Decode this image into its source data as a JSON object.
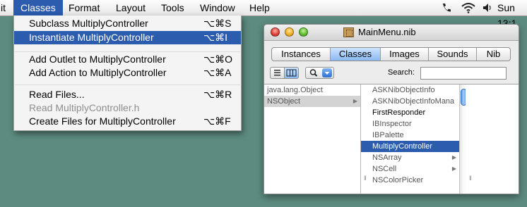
{
  "menubar": {
    "items": [
      "it",
      "Classes",
      "Format",
      "Layout",
      "Tools",
      "Window",
      "Help"
    ],
    "active_index": 1,
    "clock": "Sun 13:1"
  },
  "menu": {
    "items": [
      {
        "label": "Subclass MultiplyController",
        "shortcut": "⌥⌘S",
        "state": "normal"
      },
      {
        "label": "Instantiate MultiplyController",
        "shortcut": "⌥⌘I",
        "state": "highlighted"
      },
      {
        "label": "Add Outlet to MultiplyController",
        "shortcut": "⌥⌘O",
        "state": "normal"
      },
      {
        "label": "Add Action to MultiplyController",
        "shortcut": "⌥⌘A",
        "state": "normal"
      },
      {
        "label": "Read Files...",
        "shortcut": "⌥⌘R",
        "state": "normal"
      },
      {
        "label": "Read MultiplyController.h",
        "shortcut": "",
        "state": "disabled"
      },
      {
        "label": "Create Files for MultiplyController",
        "shortcut": "⌥⌘F",
        "state": "normal"
      }
    ]
  },
  "window": {
    "title": "MainMenu.nib",
    "tabs": [
      "Instances",
      "Classes",
      "Images",
      "Sounds",
      "Nib"
    ],
    "selected_tab": "Classes",
    "search_label": "Search:",
    "search_value": "",
    "column1": [
      {
        "label": "java.lang.Object",
        "has_children": false
      },
      {
        "label": "NSObject",
        "has_children": true,
        "selected": true
      }
    ],
    "column2": [
      {
        "label": "ASKNibObjectInfo",
        "has_children": false
      },
      {
        "label": "ASKNibObjectInfoMana",
        "has_children": false
      },
      {
        "label": "FirstResponder",
        "has_children": false
      },
      {
        "label": "IBInspector",
        "has_children": false
      },
      {
        "label": "IBPalette",
        "has_children": false
      },
      {
        "label": "MultiplyController",
        "has_children": false,
        "selected": true
      },
      {
        "label": "NSArray",
        "has_children": true
      },
      {
        "label": "NSCell",
        "has_children": true
      },
      {
        "label": "NSColorPicker",
        "has_children": false
      }
    ]
  },
  "colors": {
    "desktop": "#5d8b7f",
    "selection": "#2c5cad",
    "aqua_blue": "#8ab9f0"
  }
}
